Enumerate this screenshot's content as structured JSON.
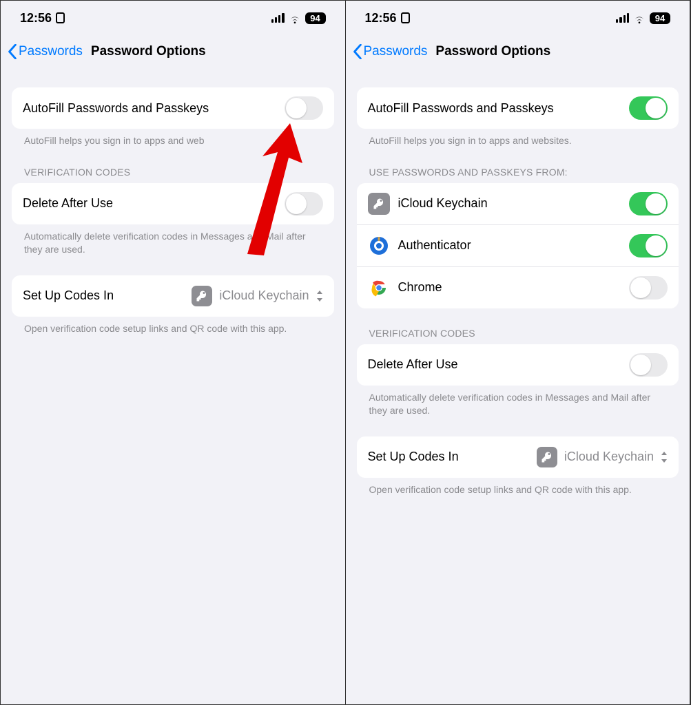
{
  "status": {
    "time": "12:56",
    "battery": "94"
  },
  "nav": {
    "back": "Passwords",
    "title": "Password Options"
  },
  "left": {
    "autofill": {
      "label": "AutoFill Passwords and Passkeys",
      "caption": "AutoFill helps you sign in to apps and web"
    },
    "verification": {
      "header": "VERIFICATION CODES",
      "delete": {
        "label": "Delete After Use",
        "caption": "Automatically delete verification codes in Messages and Mail after they are used."
      }
    },
    "setup": {
      "label": "Set Up Codes In",
      "value": "iCloud Keychain",
      "caption": "Open verification code setup links and QR code with this app."
    }
  },
  "right": {
    "autofill": {
      "label": "AutoFill Passwords and Passkeys",
      "caption": "AutoFill helps you sign in to apps and websites."
    },
    "sources": {
      "header": "USE PASSWORDS AND PASSKEYS FROM:",
      "items": [
        {
          "label": "iCloud Keychain",
          "on": true
        },
        {
          "label": "Authenticator",
          "on": true
        },
        {
          "label": "Chrome",
          "on": false
        }
      ]
    },
    "verification": {
      "header": "VERIFICATION CODES",
      "delete": {
        "label": "Delete After Use",
        "caption": "Automatically delete verification codes in Messages and Mail after they are used."
      }
    },
    "setup": {
      "label": "Set Up Codes In",
      "value": "iCloud Keychain",
      "caption": "Open verification code setup links and QR code with this app."
    }
  }
}
